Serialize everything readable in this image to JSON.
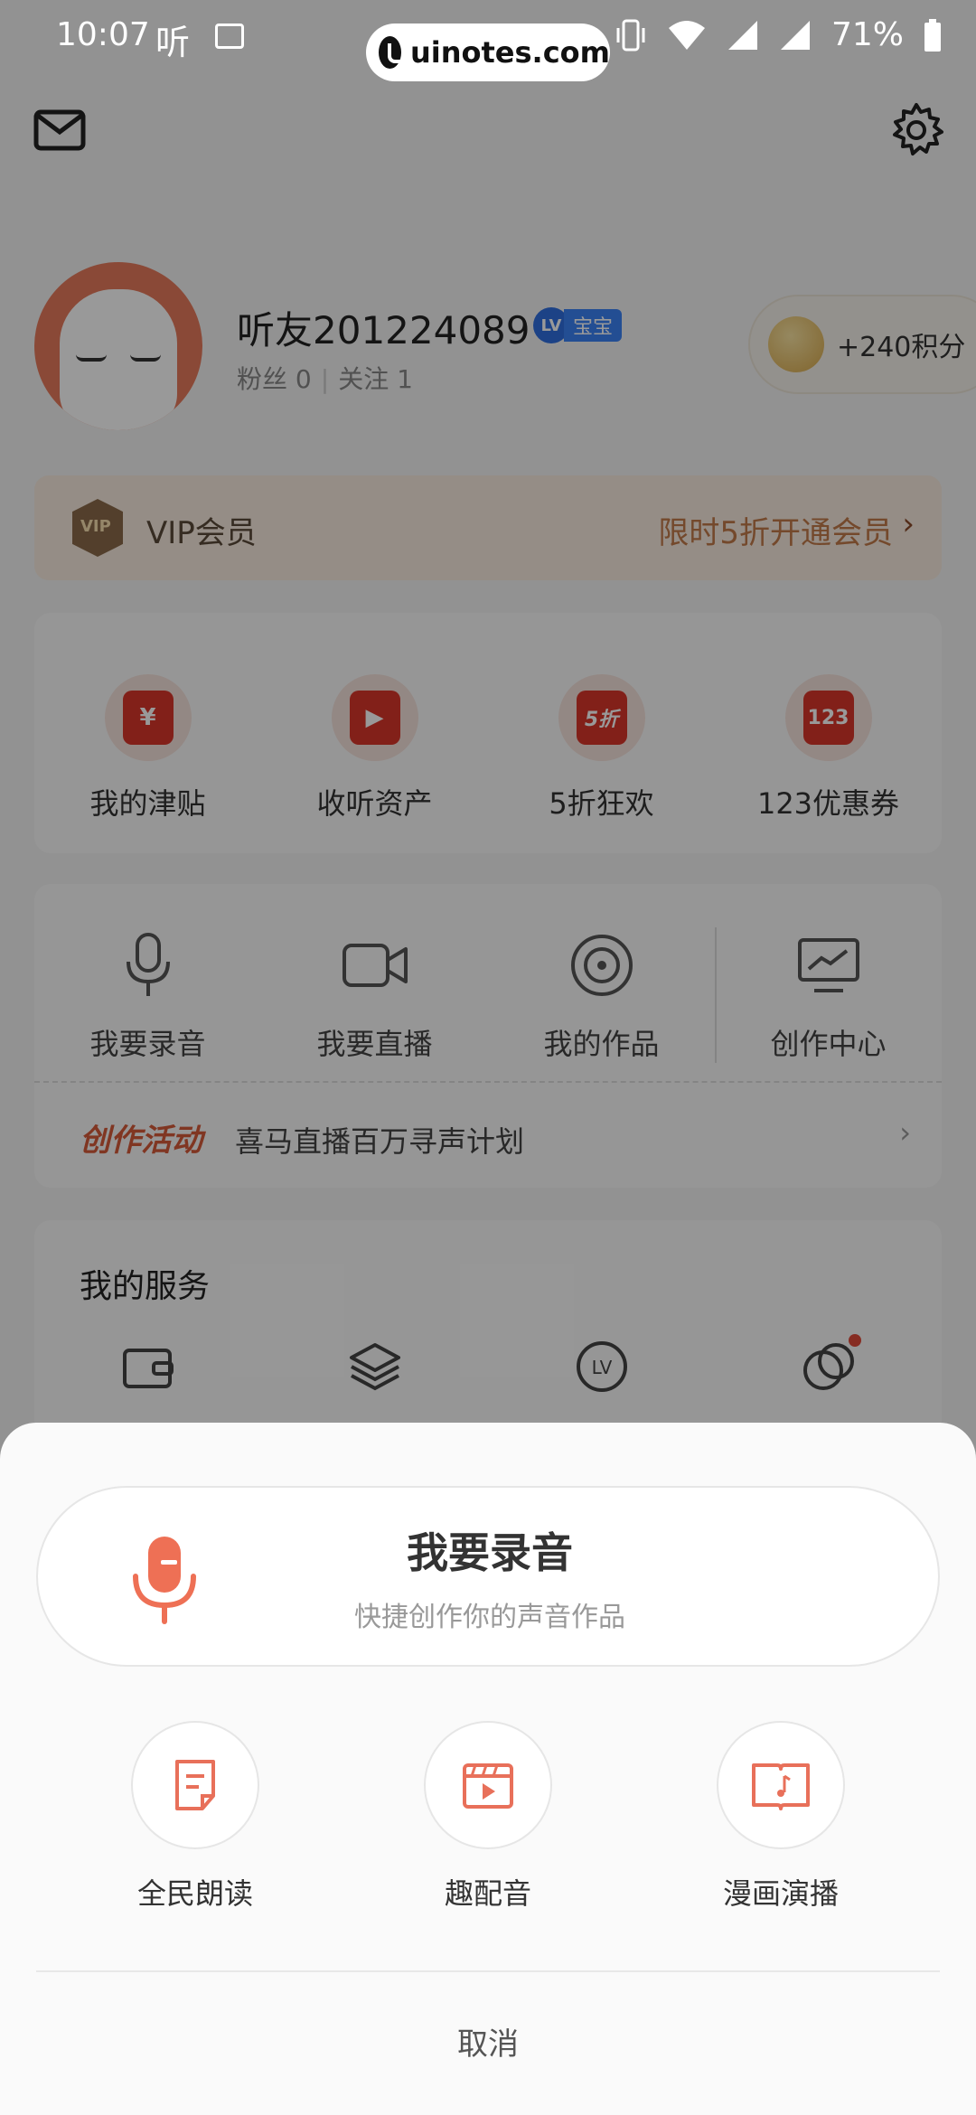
{
  "status_bar": {
    "time": "10:07",
    "app_glyph": "听",
    "battery": "71%"
  },
  "watermark": "uinotes.com",
  "header": {
    "mail_icon": "mail-icon",
    "settings_icon": "gear-icon"
  },
  "profile": {
    "name": "听友201224089",
    "level_badge_short": "LV",
    "level_badge_text": "宝宝",
    "fans_label": "粉丝",
    "fans_count": "0",
    "follow_label": "关注",
    "follow_count": "1",
    "points": "+240积分"
  },
  "vip": {
    "badge": "VIP",
    "title": "VIP会员",
    "promo": "限时5折开通会员",
    "arrow": "›"
  },
  "benefits": [
    {
      "label": "我的津贴",
      "glyph": "¥",
      "icon": "red-envelope-icon"
    },
    {
      "label": "收听资产",
      "glyph": "▶",
      "icon": "scroll-play-icon"
    },
    {
      "label": "5折狂欢",
      "glyph": "5折",
      "icon": "discount-tag-icon"
    },
    {
      "label": "123优惠券",
      "glyph": "123",
      "icon": "coupon-icon"
    }
  ],
  "creation": {
    "items": [
      {
        "label": "我要录音",
        "icon": "microphone-icon"
      },
      {
        "label": "我要直播",
        "icon": "video-camera-icon"
      },
      {
        "label": "我的作品",
        "icon": "disc-icon"
      },
      {
        "label": "创作中心",
        "icon": "monitor-chart-icon"
      }
    ],
    "activity_tag": "创作活动",
    "activity_text": "喜马直播百万寻声计划",
    "activity_arrow": "›"
  },
  "services": {
    "title": "我的服务",
    "icons": [
      "wallet-icon",
      "layers-icon",
      "level-badge-icon",
      "circles-icon"
    ],
    "level_glyph": "LV"
  },
  "sheet": {
    "record_title": "我要录音",
    "record_subtitle": "快捷创作你的声音作品",
    "options": [
      {
        "label": "全民朗读",
        "icon": "document-icon"
      },
      {
        "label": "趣配音",
        "icon": "clapper-video-icon"
      },
      {
        "label": "漫画演播",
        "icon": "open-book-music-icon"
      }
    ],
    "cancel": "取消"
  },
  "colors": {
    "accent": "#e8705a",
    "dim_overlay": "rgba(0,0,0,0.4)",
    "sheet_bg": "#fafafa"
  }
}
